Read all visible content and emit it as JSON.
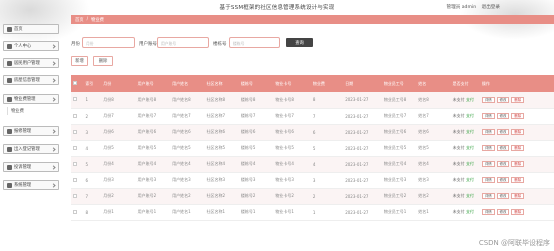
{
  "header": {
    "title": "基于SSM框架的社区信息管理系统设计与实现",
    "user_label": "管理员 admin",
    "logout": "退出登录"
  },
  "sidebar": {
    "items": [
      {
        "label": "首页",
        "icon": "home-icon"
      },
      {
        "label": "个人中心",
        "icon": "user-icon",
        "expand": true
      },
      {
        "label": "居民用户管理",
        "icon": "users-icon",
        "expand": true
      },
      {
        "label": "房屋信息管理",
        "icon": "house-icon",
        "expand": true
      },
      {
        "label": "物业费管理",
        "icon": "money-icon",
        "expand": true,
        "sub": [
          "物业费"
        ]
      },
      {
        "label": "报修管理",
        "icon": "tool-icon",
        "expand": true
      },
      {
        "label": "出入登记管理",
        "icon": "door-icon",
        "expand": true
      },
      {
        "label": "投诉管理",
        "icon": "message-icon",
        "expand": true
      },
      {
        "label": "系统管理",
        "icon": "gear-icon",
        "expand": true
      }
    ]
  },
  "breadcrumb": {
    "home": "首页",
    "sep": "/",
    "current": "物业费"
  },
  "search": {
    "month_label": "月份",
    "month_placeholder": "月份",
    "account_label": "用户账号",
    "account_placeholder": "用户账号",
    "building_label": "楼栋号",
    "building_placeholder": "楼栋号",
    "button": "查询"
  },
  "actions": {
    "add": "新增",
    "delete": "删除"
  },
  "table": {
    "headers": [
      "索引",
      "月份",
      "用户账号",
      "用户姓名",
      "社区名称",
      "楼栋号",
      "物业卡号",
      "物业费",
      "日期",
      "物业员工号",
      "姓名",
      "是否支付",
      "操作"
    ],
    "op_buttons": [
      "详情",
      "修改",
      "删除"
    ],
    "rows": [
      [
        "1",
        "月份8",
        "用户账号8",
        "用户姓名8",
        "社区名称8",
        "楼栋号8",
        "物业卡号8",
        "8",
        "2023-01-27",
        "物业员工号8",
        "姓名8",
        "未支付",
        "支付"
      ],
      [
        "2",
        "月份7",
        "用户账号7",
        "用户姓名7",
        "社区名称7",
        "楼栋号7",
        "物业卡号7",
        "7",
        "2023-01-27",
        "物业员工号7",
        "姓名7",
        "未支付",
        "支付"
      ],
      [
        "3",
        "月份6",
        "用户账号6",
        "用户姓名6",
        "社区名称6",
        "楼栋号6",
        "物业卡号6",
        "6",
        "2023-01-27",
        "物业员工号6",
        "姓名6",
        "未支付",
        "支付"
      ],
      [
        "4",
        "月份5",
        "用户账号5",
        "用户姓名5",
        "社区名称5",
        "楼栋号5",
        "物业卡号5",
        "5",
        "2023-01-27",
        "物业员工号5",
        "姓名5",
        "未支付",
        "支付"
      ],
      [
        "5",
        "月份4",
        "用户账号4",
        "用户姓名4",
        "社区名称4",
        "楼栋号4",
        "物业卡号4",
        "4",
        "2023-01-27",
        "物业员工号4",
        "姓名4",
        "未支付",
        "支付"
      ],
      [
        "6",
        "月份3",
        "用户账号3",
        "用户姓名3",
        "社区名称3",
        "楼栋号3",
        "物业卡号3",
        "3",
        "2023-01-27",
        "物业员工号3",
        "姓名3",
        "未支付",
        "支付"
      ],
      [
        "7",
        "月份2",
        "用户账号2",
        "用户姓名2",
        "社区名称2",
        "楼栋号2",
        "物业卡号2",
        "2",
        "2023-01-27",
        "物业员工号2",
        "姓名2",
        "未支付",
        "支付"
      ],
      [
        "8",
        "月份1",
        "用户账号1",
        "用户姓名1",
        "社区名称1",
        "楼栋号1",
        "物业卡号1",
        "1",
        "2023-01-27",
        "物业员工号1",
        "姓名1",
        "未支付",
        "支付"
      ]
    ]
  },
  "watermark": "CSDN @阿联毕设程序",
  "colors": {
    "accent": "#e88e86",
    "search_button": "#444444",
    "paid": "#2d9e3a",
    "delete": "#d04040"
  }
}
